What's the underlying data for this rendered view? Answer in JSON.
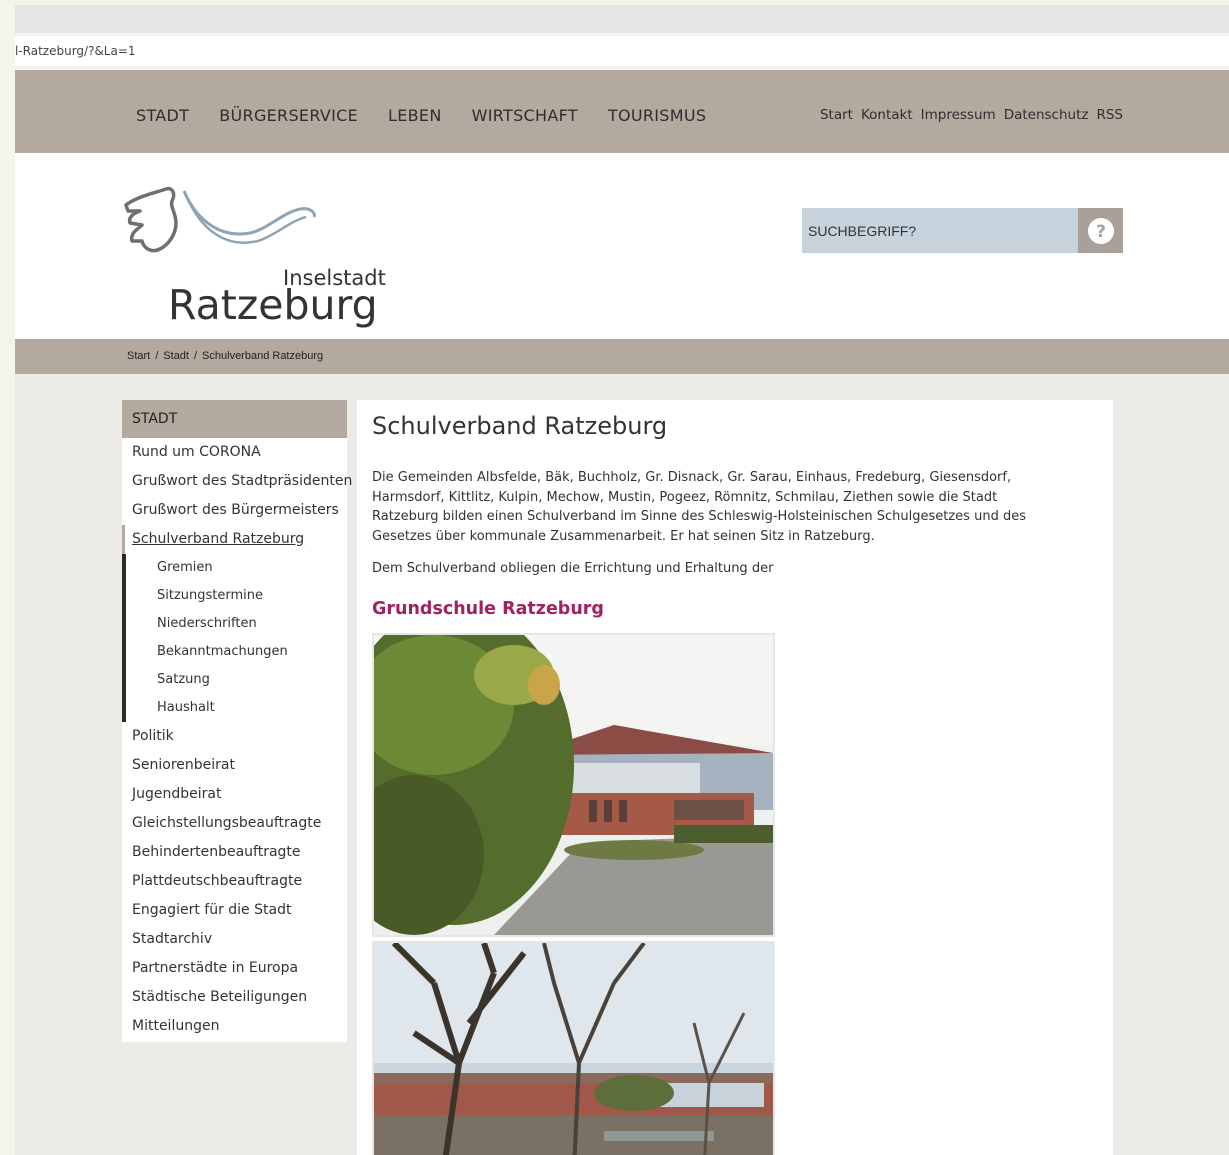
{
  "browser": {
    "url": "l-Ratzeburg/?&La=1"
  },
  "main_nav": [
    "STADT",
    "BÜRGERSERVICE",
    "LEBEN",
    "WIRTSCHAFT",
    "TOURISMUS"
  ],
  "meta_nav": [
    "Start",
    "Kontakt",
    "Impressum",
    "Datenschutz",
    "RSS"
  ],
  "logo": {
    "small_text": "Inselstadt",
    "big_text": "Ratzeburg"
  },
  "search": {
    "placeholder": "SUCHBEGRIFF?",
    "button_icon": "question-circle-icon"
  },
  "breadcrumb": [
    "Start",
    "Stadt",
    "Schulverband Ratzeburg"
  ],
  "sidebar": {
    "heading": "STADT",
    "items_before": [
      "Rund um CORONA",
      "Grußwort des Stadtpräsidenten",
      "Grußwort des Bürgermeisters"
    ],
    "active_item": "Schulverband Ratzeburg",
    "sub_items": [
      "Gremien",
      "Sitzungstermine",
      "Niederschriften",
      "Bekanntmachungen",
      "Satzung",
      "Haushalt"
    ],
    "items_after": [
      "Politik",
      "Seniorenbeirat",
      "Jugendbeirat",
      "Gleichstellungsbeauftragte",
      "Behindertenbeauftragte",
      "Plattdeutschbeauftragte",
      "Engagiert für die Stadt",
      "Stadtarchiv",
      "Partnerstädte in Europa",
      "Städtische Beteiligungen",
      "Mitteilungen"
    ]
  },
  "content": {
    "title": "Schulverband Ratzeburg",
    "paragraph1": "Die Gemeinden Albsfelde, Bäk, Buchholz, Gr. Disnack, Gr. Sarau, Einhaus, Fredeburg, Giesensdorf, Harmsdorf, Kittlitz, Kulpin, Mechow, Mustin, Pogeez, Römnitz, Schmilau, Ziethen sowie die Stadt Ratzeburg bilden einen Schulverband im Sinne des Schleswig-Holsteinischen Schulgesetzes und des Gesetzes über kommunale Zusammenarbeit. Er hat seinen Sitz in Ratzeburg.",
    "paragraph2": "Dem Schulverband obliegen die Errichtung und Erhaltung der",
    "subheading": "Grundschule Ratzeburg"
  },
  "colors": {
    "nav_bg": "#b3a99f",
    "page_bg": "#ecebe6",
    "search_bg": "#c7d3dc",
    "accent": "#a3215d"
  }
}
